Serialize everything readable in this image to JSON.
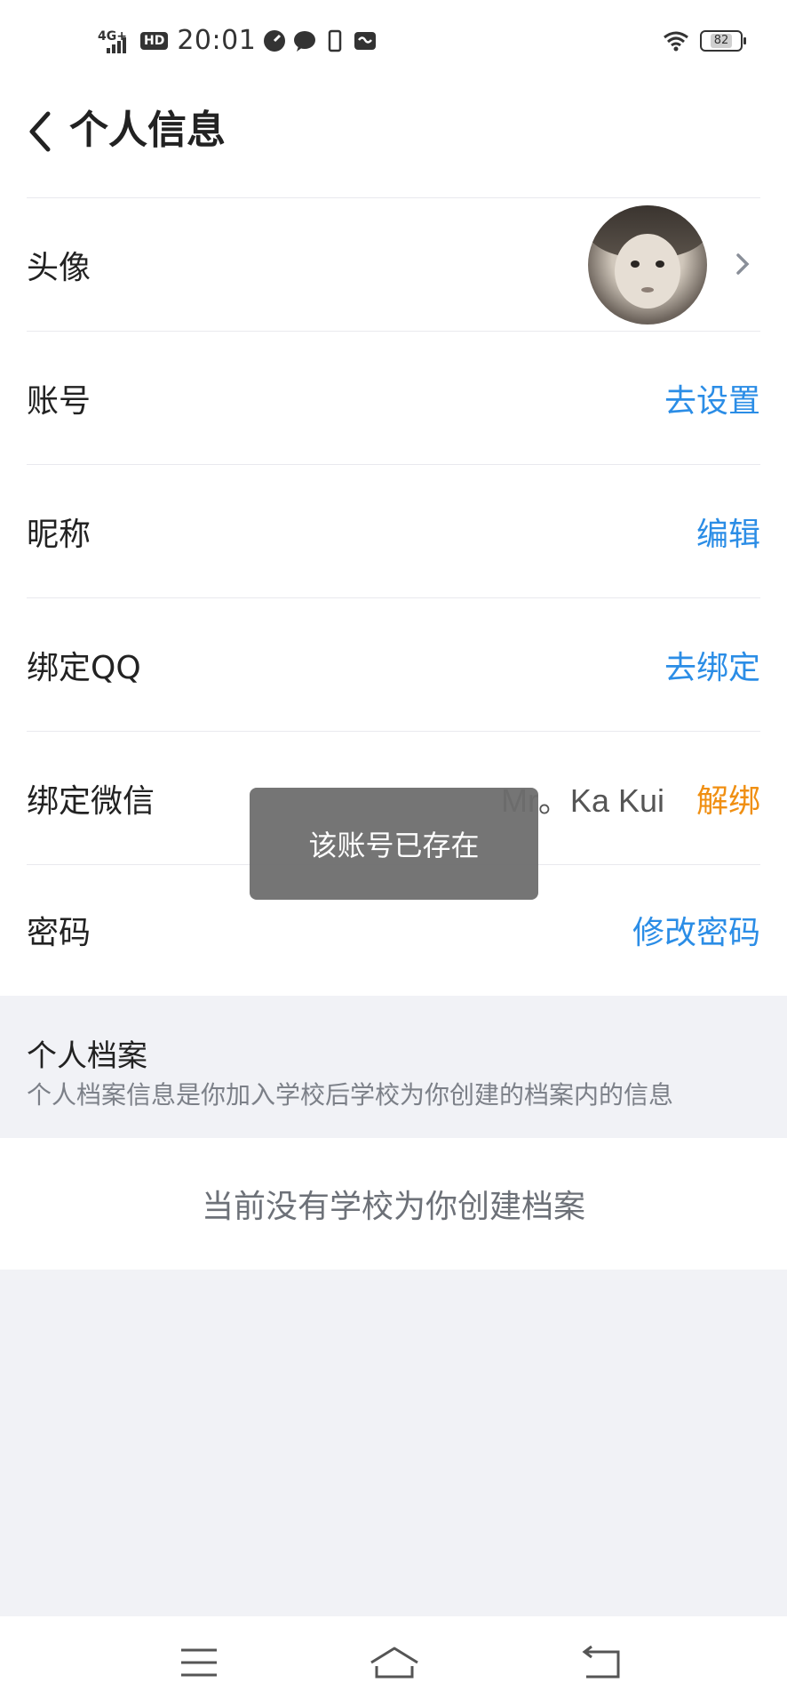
{
  "status_bar": {
    "network": "4G+",
    "hd_badge": "HD",
    "time": "20:01",
    "battery": "82"
  },
  "header": {
    "title": "个人信息"
  },
  "rows": {
    "avatar_label": "头像",
    "account_label": "账号",
    "account_action": "去设置",
    "nickname_label": "昵称",
    "nickname_action": "编辑",
    "qq_label": "绑定QQ",
    "qq_action": "去绑定",
    "wechat_label": "绑定微信",
    "wechat_value": "Mr。Ka Kui",
    "wechat_action": "解绑",
    "password_label": "密码",
    "password_action": "修改密码"
  },
  "profile_section": {
    "title": "个人档案",
    "subtitle": "个人档案信息是你加入学校后学校为你创建的档案内的信息",
    "empty_text": "当前没有学校为你创建档案"
  },
  "toast": {
    "message": "该账号已存在"
  },
  "colors": {
    "link_blue": "#2b8de6",
    "unbind_orange": "#f08f12",
    "section_bg": "#f1f2f6"
  }
}
